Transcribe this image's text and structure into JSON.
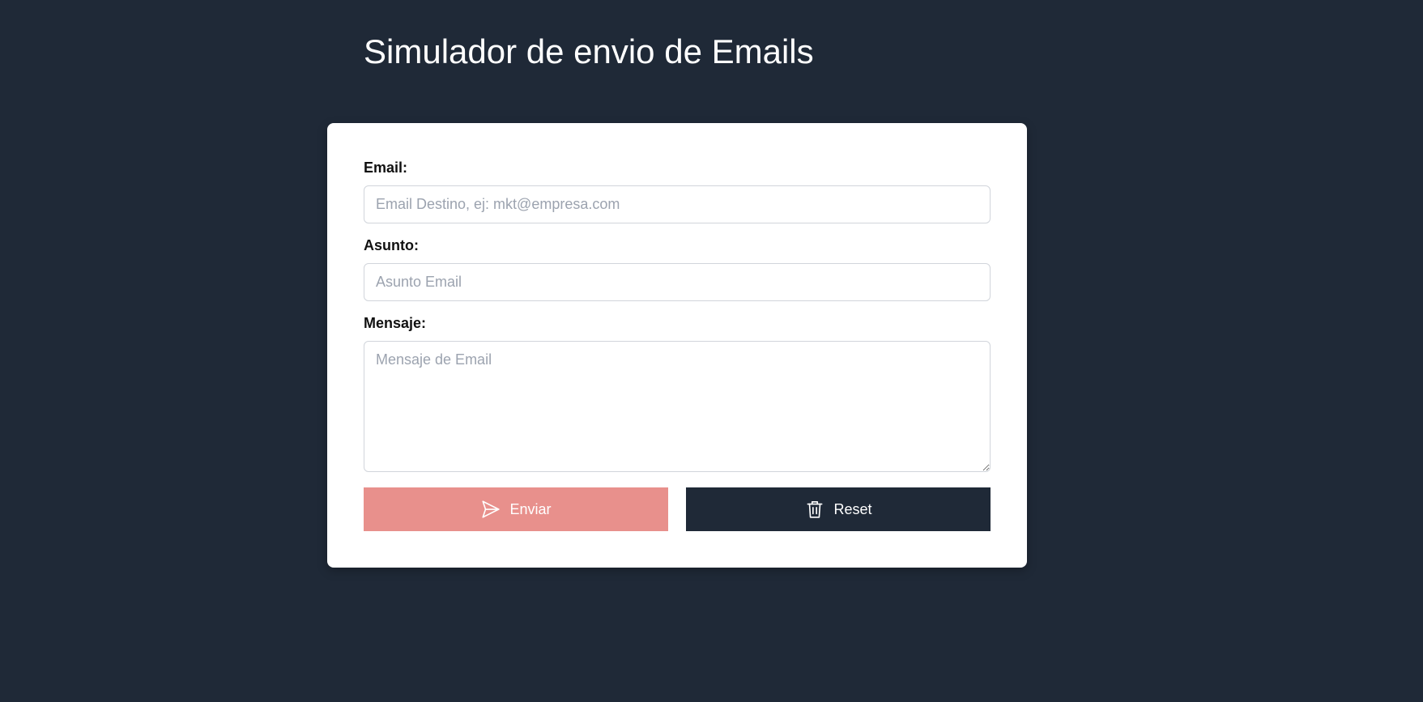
{
  "header": {
    "title": "Simulador de envio de Emails"
  },
  "form": {
    "email": {
      "label": "Email:",
      "placeholder": "Email Destino, ej: mkt@empresa.com",
      "value": ""
    },
    "subject": {
      "label": "Asunto:",
      "placeholder": "Asunto Email",
      "value": ""
    },
    "message": {
      "label": "Mensaje:",
      "placeholder": "Mensaje de Email",
      "value": ""
    },
    "buttons": {
      "send_label": "Enviar",
      "send_icon": "paper-plane-icon",
      "reset_label": "Reset",
      "reset_icon": "trash-icon"
    }
  },
  "colors": {
    "background": "#1f2937",
    "card": "#ffffff",
    "send_button": "#e8908c",
    "reset_button": "#1f2937",
    "input_border": "#d1d5db",
    "placeholder": "#9ca3af"
  }
}
